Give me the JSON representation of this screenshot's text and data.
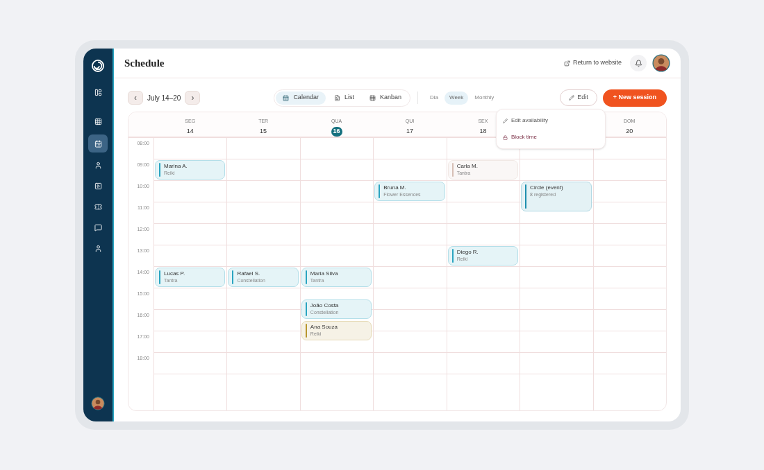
{
  "sidebar": {
    "items": [
      {
        "kind": "panel",
        "selected": false
      },
      {
        "kind": "grid",
        "selected": false
      },
      {
        "kind": "calendar",
        "selected": true
      },
      {
        "kind": "person",
        "selected": false
      },
      {
        "kind": "video",
        "selected": false
      },
      {
        "kind": "ticket",
        "selected": false
      },
      {
        "kind": "chat",
        "selected": false
      },
      {
        "kind": "person",
        "selected": false
      }
    ]
  },
  "header": {
    "title": "Schedule",
    "return_link": "Return to website"
  },
  "toolbar": {
    "prev": "‹",
    "range": "July 14–20",
    "next": "›",
    "views": [
      {
        "label": "Calendar",
        "kind": "calendar",
        "selected": true
      },
      {
        "label": "List",
        "kind": "list",
        "selected": false
      },
      {
        "label": "Kanban",
        "kind": "kanban",
        "selected": false
      }
    ],
    "periods": [
      {
        "label": "Dia",
        "selected": false
      },
      {
        "label": "Week",
        "selected": true
      },
      {
        "label": "Monthly",
        "selected": false
      }
    ],
    "edit": "Edit",
    "new_session": "+ New session"
  },
  "edit_menu": [
    {
      "label": "Edit availability",
      "kind": "edit"
    },
    {
      "label": "Block time",
      "kind": "block"
    }
  ],
  "days": [
    {
      "label": "SEG",
      "number": "14",
      "today": false,
      "gap_before": false
    },
    {
      "label": "TER",
      "number": "15",
      "today": false,
      "gap_before": false
    },
    {
      "label": "QUA",
      "number": "16",
      "today": true,
      "gap_before": false
    },
    {
      "label": "QUI",
      "number": "17",
      "today": false,
      "gap_before": false
    },
    {
      "label": "SEX",
      "number": "18",
      "today": false,
      "gap_before": false
    },
    {
      "label": "DOM",
      "number": "20",
      "today": false,
      "gap_before": true
    }
  ],
  "rows": [
    {
      "time": "08:00",
      "cells": [
        {
          "kind": "empty"
        },
        {
          "kind": "empty"
        },
        {
          "kind": "empty"
        },
        {
          "kind": "empty"
        },
        {
          "kind": "empty"
        },
        {
          "kind": "empty"
        },
        {
          "kind": "empty"
        }
      ]
    },
    {
      "time": "09:00",
      "cells": [
        {
          "kind": "session",
          "name": "Marina A.",
          "detail": "Reiki",
          "color": "#2aa4c0"
        },
        {
          "kind": "empty"
        },
        {
          "kind": "empty"
        },
        {
          "kind": "empty"
        },
        {
          "kind": "session",
          "name": "Carla M.",
          "detail": "Tantra",
          "color": "#d6bfb5"
        },
        {
          "kind": "empty"
        },
        {
          "kind": "empty"
        }
      ]
    },
    {
      "time": "10:00",
      "cells": [
        {
          "kind": "empty"
        },
        {
          "kind": "empty"
        },
        {
          "kind": "empty"
        },
        {
          "kind": "session",
          "name": "Bruna M.",
          "detail": "Flower Essences",
          "color": "#2aa4c0"
        },
        {
          "kind": "empty"
        },
        {
          "kind": "long",
          "name": "Circle (event)",
          "detail": "8 registered",
          "color": "#1e8fae"
        },
        {
          "kind": "empty"
        }
      ]
    },
    {
      "time": "11:00",
      "cells": [
        {
          "kind": "empty"
        },
        {
          "kind": "empty"
        },
        {
          "kind": "empty"
        },
        {
          "kind": "empty"
        },
        {
          "kind": "empty"
        },
        {
          "kind": "empty"
        },
        {
          "kind": "empty"
        }
      ]
    },
    {
      "time": "12:00",
      "cells": [
        {
          "kind": "empty"
        },
        {
          "kind": "empty"
        },
        {
          "kind": "empty"
        },
        {
          "kind": "empty"
        },
        {
          "kind": "empty"
        },
        {
          "kind": "empty"
        },
        {
          "kind": "empty"
        }
      ]
    },
    {
      "time": "13:00",
      "cells": [
        {
          "kind": "empty"
        },
        {
          "kind": "empty"
        },
        {
          "kind": "empty"
        },
        {
          "kind": "empty"
        },
        {
          "kind": "session",
          "name": "Diego R.",
          "detail": "Reiki",
          "color": "#2aa4c0"
        },
        {
          "kind": "empty"
        },
        {
          "kind": "empty"
        }
      ]
    },
    {
      "time": "14:00",
      "cells": [
        {
          "kind": "session",
          "name": "Lucas P.",
          "detail": "Tantra",
          "color": "#2aa4c0"
        },
        {
          "kind": "session",
          "name": "Rafael S.",
          "detail": "Constellation",
          "color": "#2aa4c0"
        },
        {
          "kind": "session",
          "name": "Maria Silva",
          "detail": "Tantra",
          "color": "#2aa4c0"
        },
        {
          "kind": "empty"
        },
        {
          "kind": "empty"
        },
        {
          "kind": "empty"
        },
        {
          "kind": "empty"
        }
      ]
    },
    {
      "time": "15:00",
      "cells": [
        {
          "kind": "empty"
        },
        {
          "kind": "empty"
        },
        {
          "kind": "half_past",
          "name": "João Costa",
          "detail": "Constellation",
          "color": "#2aa4c0"
        },
        {
          "kind": "empty"
        },
        {
          "kind": "empty"
        },
        {
          "kind": "empty"
        },
        {
          "kind": "empty"
        }
      ]
    },
    {
      "time": "16:00",
      "cells": [
        {
          "kind": "empty"
        },
        {
          "kind": "empty"
        },
        {
          "kind": "half_past",
          "name": "Ana Souza",
          "detail": "Reiki",
          "color": "#b8962e"
        },
        {
          "kind": "empty"
        },
        {
          "kind": "empty"
        },
        {
          "kind": "empty"
        },
        {
          "kind": "empty"
        }
      ]
    },
    {
      "time": "17:00",
      "cells": [
        {
          "kind": "empty"
        },
        {
          "kind": "empty"
        },
        {
          "kind": "empty"
        },
        {
          "kind": "empty"
        },
        {
          "kind": "empty"
        },
        {
          "kind": "empty"
        },
        {
          "kind": "empty"
        }
      ]
    },
    {
      "time": "18:00",
      "cells": [
        {
          "kind": "empty"
        },
        {
          "kind": "empty"
        },
        {
          "kind": "empty"
        },
        {
          "kind": "empty"
        },
        {
          "kind": "empty"
        },
        {
          "kind": "empty"
        },
        {
          "kind": "empty"
        }
      ]
    }
  ]
}
